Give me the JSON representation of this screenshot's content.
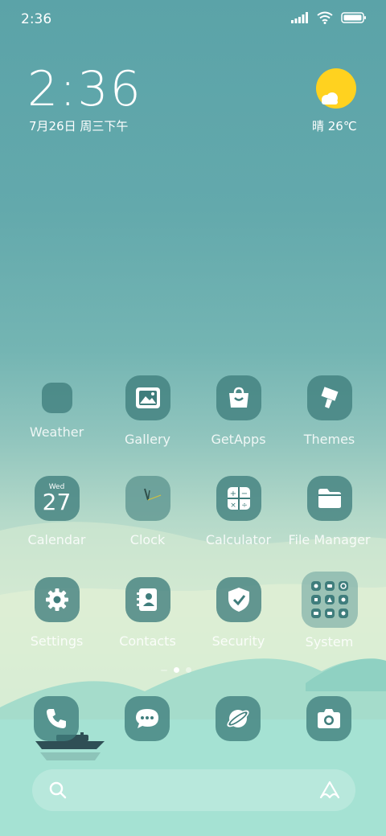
{
  "status_bar": {
    "time": "2:36"
  },
  "lockclock": {
    "time": "2:36",
    "date": "7月26日 周三下午"
  },
  "weather_widget": {
    "condition_temp": "晴 26℃"
  },
  "apps": [
    {
      "label": "Weather",
      "icon": "weather-icon"
    },
    {
      "label": "Gallery",
      "icon": "gallery-icon"
    },
    {
      "label": "GetApps",
      "icon": "shopping-bag-icon"
    },
    {
      "label": "Themes",
      "icon": "paintbrush-icon"
    },
    {
      "label": "Calendar",
      "icon": "calendar-icon",
      "day": "Wed",
      "num": "27"
    },
    {
      "label": "Clock",
      "icon": "clock-icon"
    },
    {
      "label": "Calculator",
      "icon": "calculator-icon"
    },
    {
      "label": "File Manager",
      "icon": "folder-icon"
    },
    {
      "label": "Settings",
      "icon": "gear-icon"
    },
    {
      "label": "Contacts",
      "icon": "contacts-book-icon"
    },
    {
      "label": "Security",
      "icon": "shield-check-icon"
    },
    {
      "label": "System",
      "icon": "folder-grid-icon"
    }
  ],
  "dock": [
    {
      "icon": "phone-icon"
    },
    {
      "icon": "messages-icon"
    },
    {
      "icon": "browser-icon"
    },
    {
      "icon": "camera-icon"
    }
  ],
  "page_indicator": {
    "pages": 2,
    "active": 1
  },
  "search_bar": {
    "icon": "search-icon",
    "logo": "assistant-logo-icon"
  },
  "colors": {
    "icon_bg": "#3f7d7c",
    "sun": "#ffd21f",
    "background_top": "#5ba3a8"
  }
}
